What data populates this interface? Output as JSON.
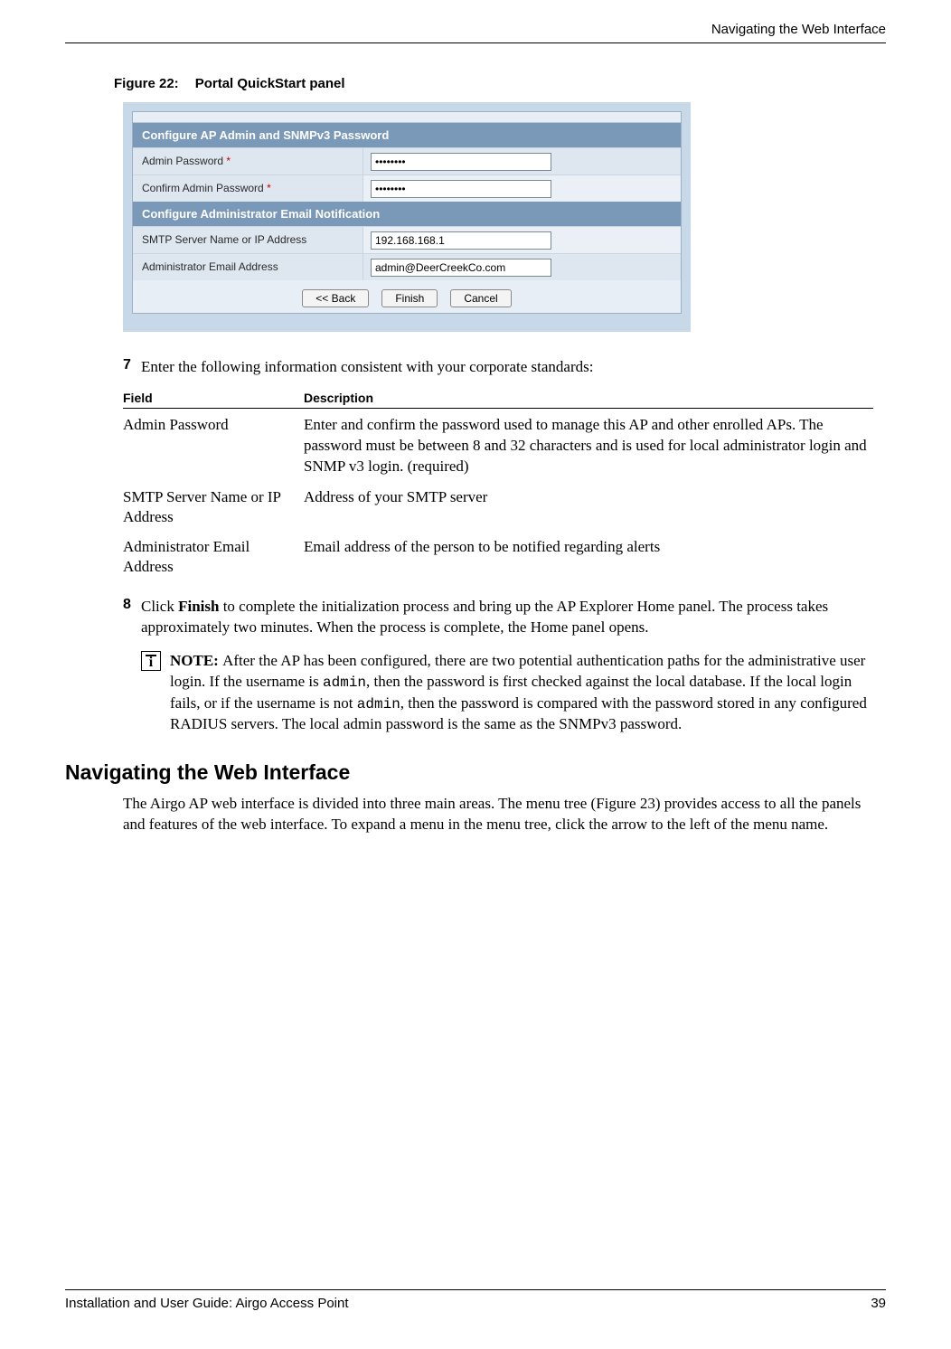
{
  "header": {
    "running_head": "Navigating the Web Interface"
  },
  "figure": {
    "label": "Figure 22:",
    "title": "Portal QuickStart panel"
  },
  "panel": {
    "sections": [
      {
        "title": "Configure AP Admin and SNMPv3 Password",
        "rows": [
          {
            "label": "Admin Password",
            "value": "••••••••"
          },
          {
            "label": "Confirm Admin Password",
            "value": "••••••••"
          }
        ]
      },
      {
        "title": "Configure Administrator Email Notification",
        "rows": [
          {
            "label": "SMTP Server Name or IP Address",
            "value": "192.168.168.1"
          },
          {
            "label": "Administrator Email Address",
            "value": "admin@DeerCreekCo.com"
          }
        ]
      }
    ],
    "buttons": {
      "back": "<< Back",
      "finish": "Finish",
      "cancel": "Cancel"
    }
  },
  "steps": [
    {
      "num": "7",
      "text": "Enter the following information consistent with your corporate standards:"
    },
    {
      "num": "8",
      "pre": "Click ",
      "bold": "Finish",
      "post": " to complete the initialization process and bring up the AP Explorer Home panel. The process takes approximately two minutes. When the process is complete, the Home panel opens."
    }
  ],
  "table": {
    "headers": [
      "Field",
      "Description"
    ],
    "rows": [
      {
        "field": "Admin Password",
        "desc": "Enter and confirm the password used to manage this AP and other enrolled APs. The password must be between 8 and 32 characters and is used for local administrator login and SNMP v3 login. (required)"
      },
      {
        "field": "SMTP Server Name or IP Address",
        "desc": "Address of your SMTP server"
      },
      {
        "field": "Administrator Email Address",
        "desc": "Email address of the person to be notified regarding alerts"
      }
    ]
  },
  "note": {
    "prefix": "NOTE: ",
    "part1": "After the AP has been configured, there are two potential authentication paths for the administrative user login. If the username is ",
    "mono1": "admin",
    "part2": ", then the password is first checked against the local database. If the local login fails, or if the username is not ",
    "mono2": "admin",
    "part3": ", then the password is compared with the password stored in any configured RADIUS servers. The local admin password is the same as the SNMPv3 password."
  },
  "section2": {
    "title": "Navigating the Web Interface",
    "body": "The Airgo AP web interface is divided into three main areas. The menu tree (Figure 23) provides access to all the panels and features of the web interface. To expand a menu in the menu tree, click the arrow to the left of the menu name."
  },
  "footer": {
    "left": "Installation and User Guide: Airgo Access Point",
    "page": "39"
  }
}
